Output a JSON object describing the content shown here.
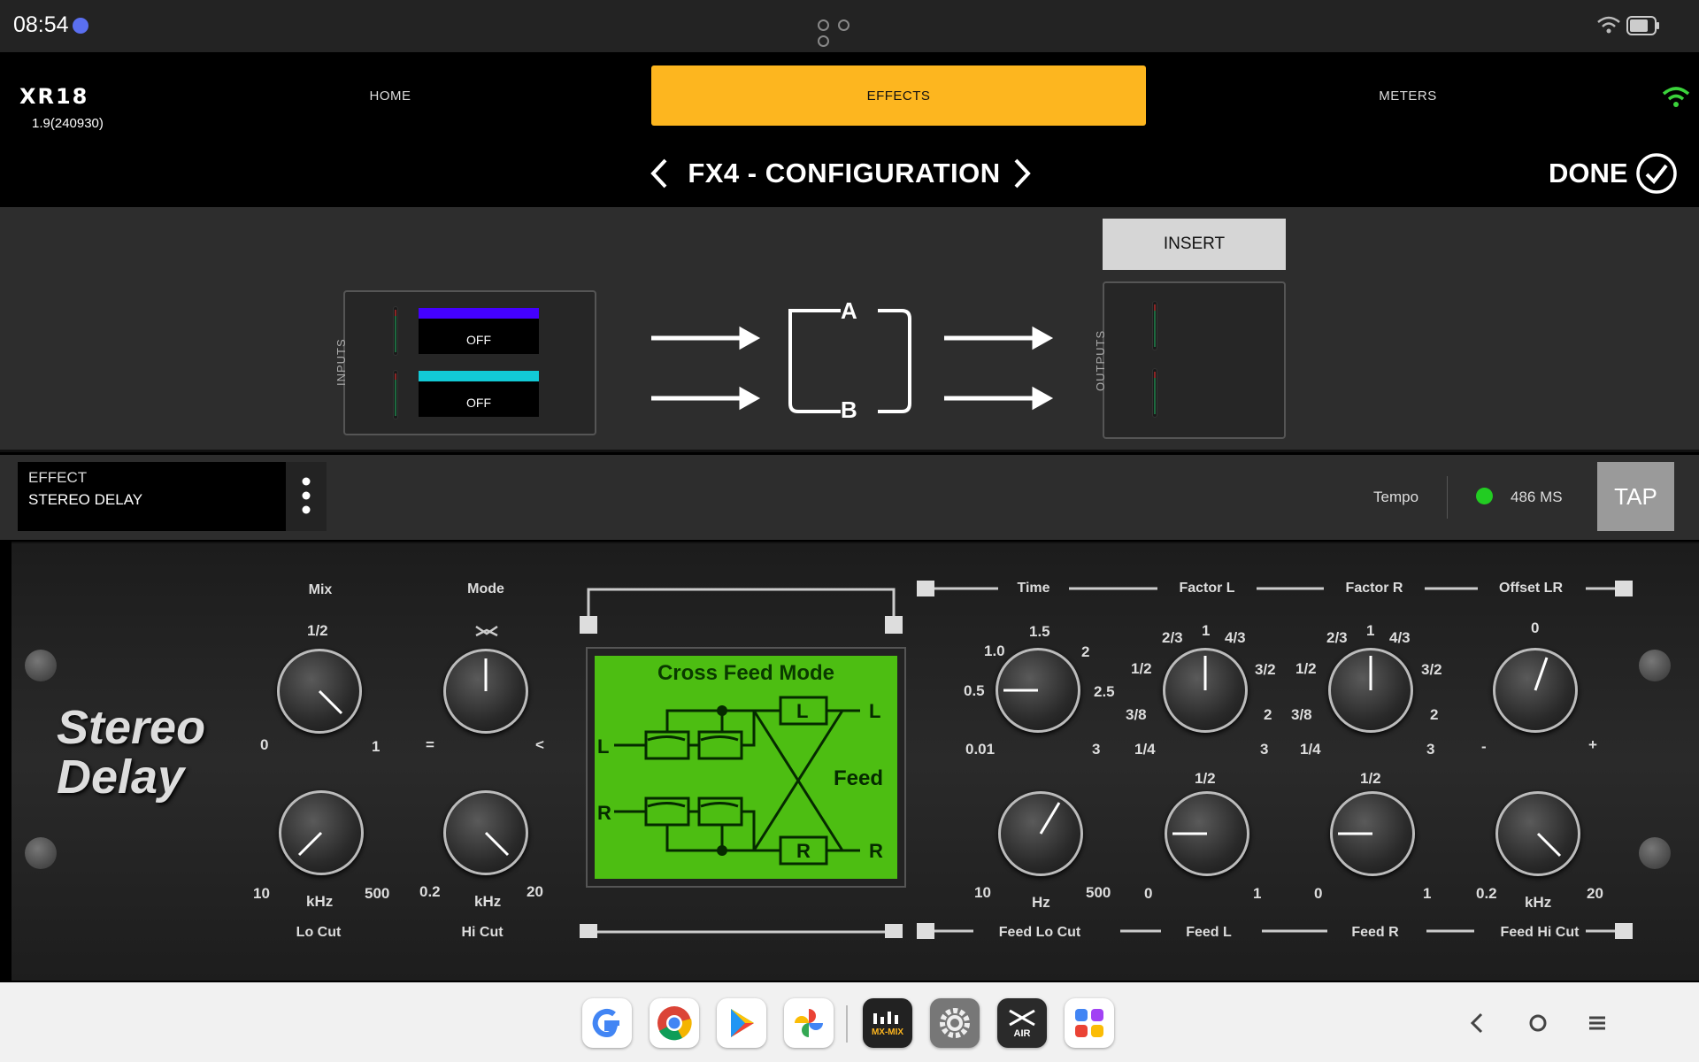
{
  "status_bar": {
    "time": "08:54"
  },
  "header": {
    "logo": "XR18",
    "version": "1.9(240930)",
    "tabs": [
      {
        "label": "HOME",
        "active": false
      },
      {
        "label": "EFFECTS",
        "active": true
      },
      {
        "label": "METERS",
        "active": false
      }
    ]
  },
  "titlebar": {
    "title": "FX4 - CONFIGURATION",
    "done_label": "DONE"
  },
  "routing": {
    "inputs_label": "INPUTS",
    "outputs_label": "OUTPUTS",
    "input_a": {
      "label": "OFF",
      "color": "#4400ff"
    },
    "input_b": {
      "label": "OFF",
      "color": "#12c9d6"
    },
    "node_a": "A",
    "node_b": "B",
    "insert_label": "INSERT"
  },
  "effect": {
    "heading": "EFFECT",
    "name": "STEREO DELAY",
    "tempo_label": "Tempo",
    "tempo_value": "486 MS",
    "tap_label": "TAP",
    "led_color": "#22cc22"
  },
  "plugin": {
    "name_line1": "Stereo",
    "name_line2": "Delay",
    "mix": {
      "label": "Mix",
      "top": "1/2",
      "min": "0",
      "max": "1"
    },
    "mode": {
      "label": "Mode",
      "min": "=",
      "max": "<"
    },
    "locut": {
      "label": "Lo Cut",
      "unit": "kHz",
      "min": "10",
      "max": "500"
    },
    "hicut": {
      "label": "Hi Cut",
      "unit": "kHz",
      "min": "0.2",
      "max": "20"
    },
    "screen": {
      "title": "Cross Feed Mode",
      "feed": "Feed",
      "l": "L",
      "r": "R"
    },
    "time": {
      "label": "Time",
      "t1": "1.5",
      "t2": "2",
      "t3": "2.5",
      "t4": "3",
      "l1": "1.0",
      "l2": "0.5",
      "l3": "0.01"
    },
    "factor_l": {
      "label": "Factor L",
      "t1": "2/3",
      "t2": "1",
      "t3": "4/3",
      "r1": "3/2",
      "r2": "2",
      "r3": "3",
      "l1": "1/2",
      "l2": "3/8",
      "l3": "1/4"
    },
    "factor_r": {
      "label": "Factor R",
      "t1": "2/3",
      "t2": "1",
      "t3": "4/3",
      "r1": "3/2",
      "r2": "2",
      "r3": "3",
      "l1": "1/2",
      "l2": "3/8",
      "l3": "1/4"
    },
    "offset": {
      "label": "Offset LR",
      "top": "0",
      "min": "-",
      "max": "+"
    },
    "feed_locut": {
      "label": "Feed Lo Cut",
      "unit": "Hz",
      "min": "10",
      "max": "500"
    },
    "feed_l": {
      "label": "Feed L",
      "top": "1/2",
      "min": "0",
      "max": "1"
    },
    "feed_r": {
      "label": "Feed R",
      "top": "1/2",
      "min": "0",
      "max": "1"
    },
    "feed_hicut": {
      "label": "Feed Hi Cut",
      "unit": "kHz",
      "min": "0.2",
      "max": "20"
    }
  },
  "dock": {
    "apps": [
      "google-icon",
      "chrome-icon",
      "play-store-icon",
      "photos-icon",
      "mx-mix-icon",
      "settings-icon",
      "x-air-icon",
      "app-grid-icon"
    ],
    "mxmix_label": "MX-MIX",
    "air_label": "AIR"
  }
}
